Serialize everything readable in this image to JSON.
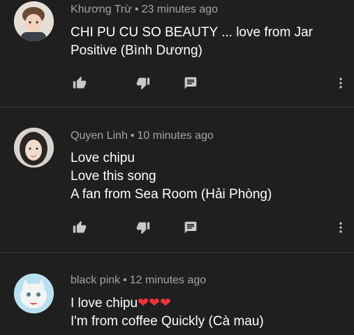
{
  "comments": [
    {
      "author": "Khương Trừ",
      "time": "23 minutes ago",
      "lines": [
        "CHI PU CU SO BEAUTY ... love from Jar",
        "Positive (Bình Dương)"
      ]
    },
    {
      "author": "Quyen Linh",
      "time": "10 minutes ago",
      "lines": [
        "Love chipu",
        "Love this song",
        "A fan from Sea Room (Hải Phòng)"
      ]
    },
    {
      "author": "black pink",
      "time": "12 minutes ago",
      "lines": [
        "I love chipu",
        "I'm from coffee Quickly (Cà mau)"
      ],
      "emoji": "❤❤❤"
    }
  ],
  "separator": "•",
  "icons": {
    "like": "thumbs-up-icon",
    "dislike": "thumbs-down-icon",
    "reply": "reply-icon",
    "more": "more-vertical-icon"
  },
  "colors": {
    "background": "#1f1f1f",
    "meta_text": "#a4a4a4",
    "icon": "#c8c8c8",
    "heart": "#e8343a"
  }
}
